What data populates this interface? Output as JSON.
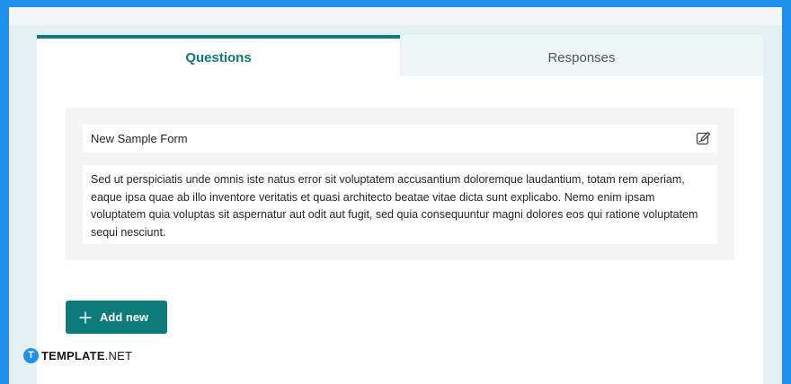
{
  "tabs": {
    "questions": "Questions",
    "responses": "Responses"
  },
  "form": {
    "title": "New Sample Form",
    "description": "Sed ut perspiciatis unde omnis iste natus error sit voluptatem accusantium doloremque laudantium, totam rem aperiam, eaque ipsa quae ab illo inventore veritatis et quasi architecto beatae vitae dicta sunt explicabo. Nemo enim ipsam voluptatem quia voluptas sit aspernatur aut odit aut fugit, sed quia consequuntur magni dolores eos qui ratione voluptatem sequi nesciunt."
  },
  "add_button": {
    "label": "Add new",
    "icon": "plus-icon"
  },
  "watermark": {
    "mark": "T",
    "brand": "TEMPLATE",
    "suffix": ".NET"
  },
  "colors": {
    "accent": "#0e7b7b",
    "border_blue": "#1e90ee",
    "background": "#e4f0f2"
  }
}
